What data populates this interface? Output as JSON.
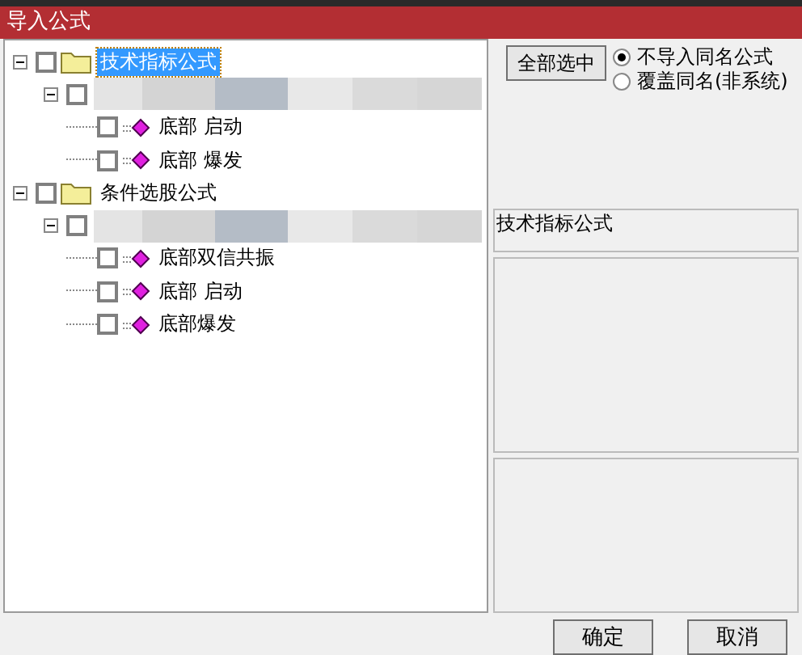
{
  "window": {
    "title": "导入公式"
  },
  "tree": [
    {
      "kind": "folder",
      "label": "技术指标公式",
      "expanded": true,
      "checked": false,
      "selected": true,
      "children": [
        {
          "kind": "group",
          "expanded": true,
          "checked": false,
          "selected": false,
          "children": [
            {
              "kind": "formula",
              "label": "底部 启动",
              "checked": false,
              "selected": false
            },
            {
              "kind": "formula",
              "label": "底部 爆发",
              "checked": false,
              "selected": false
            }
          ]
        }
      ]
    },
    {
      "kind": "folder",
      "label": "条件选股公式",
      "expanded": true,
      "checked": false,
      "selected": false,
      "children": [
        {
          "kind": "group",
          "expanded": true,
          "checked": false,
          "selected": false,
          "children": [
            {
              "kind": "formula",
              "label": "底部双信共振",
              "checked": false,
              "selected": false
            },
            {
              "kind": "formula",
              "label": "底部 启动",
              "checked": false,
              "selected": false
            },
            {
              "kind": "formula",
              "label": "底部爆发",
              "checked": false,
              "selected": false
            }
          ]
        }
      ]
    }
  ],
  "select_all_button": "全部选中",
  "options": [
    {
      "label": "不导入同名公式",
      "selected": true
    },
    {
      "label": "覆盖同名(非系统)",
      "selected": false
    }
  ],
  "description": "技术指标公式",
  "buttons": [
    "确定",
    "取消"
  ]
}
